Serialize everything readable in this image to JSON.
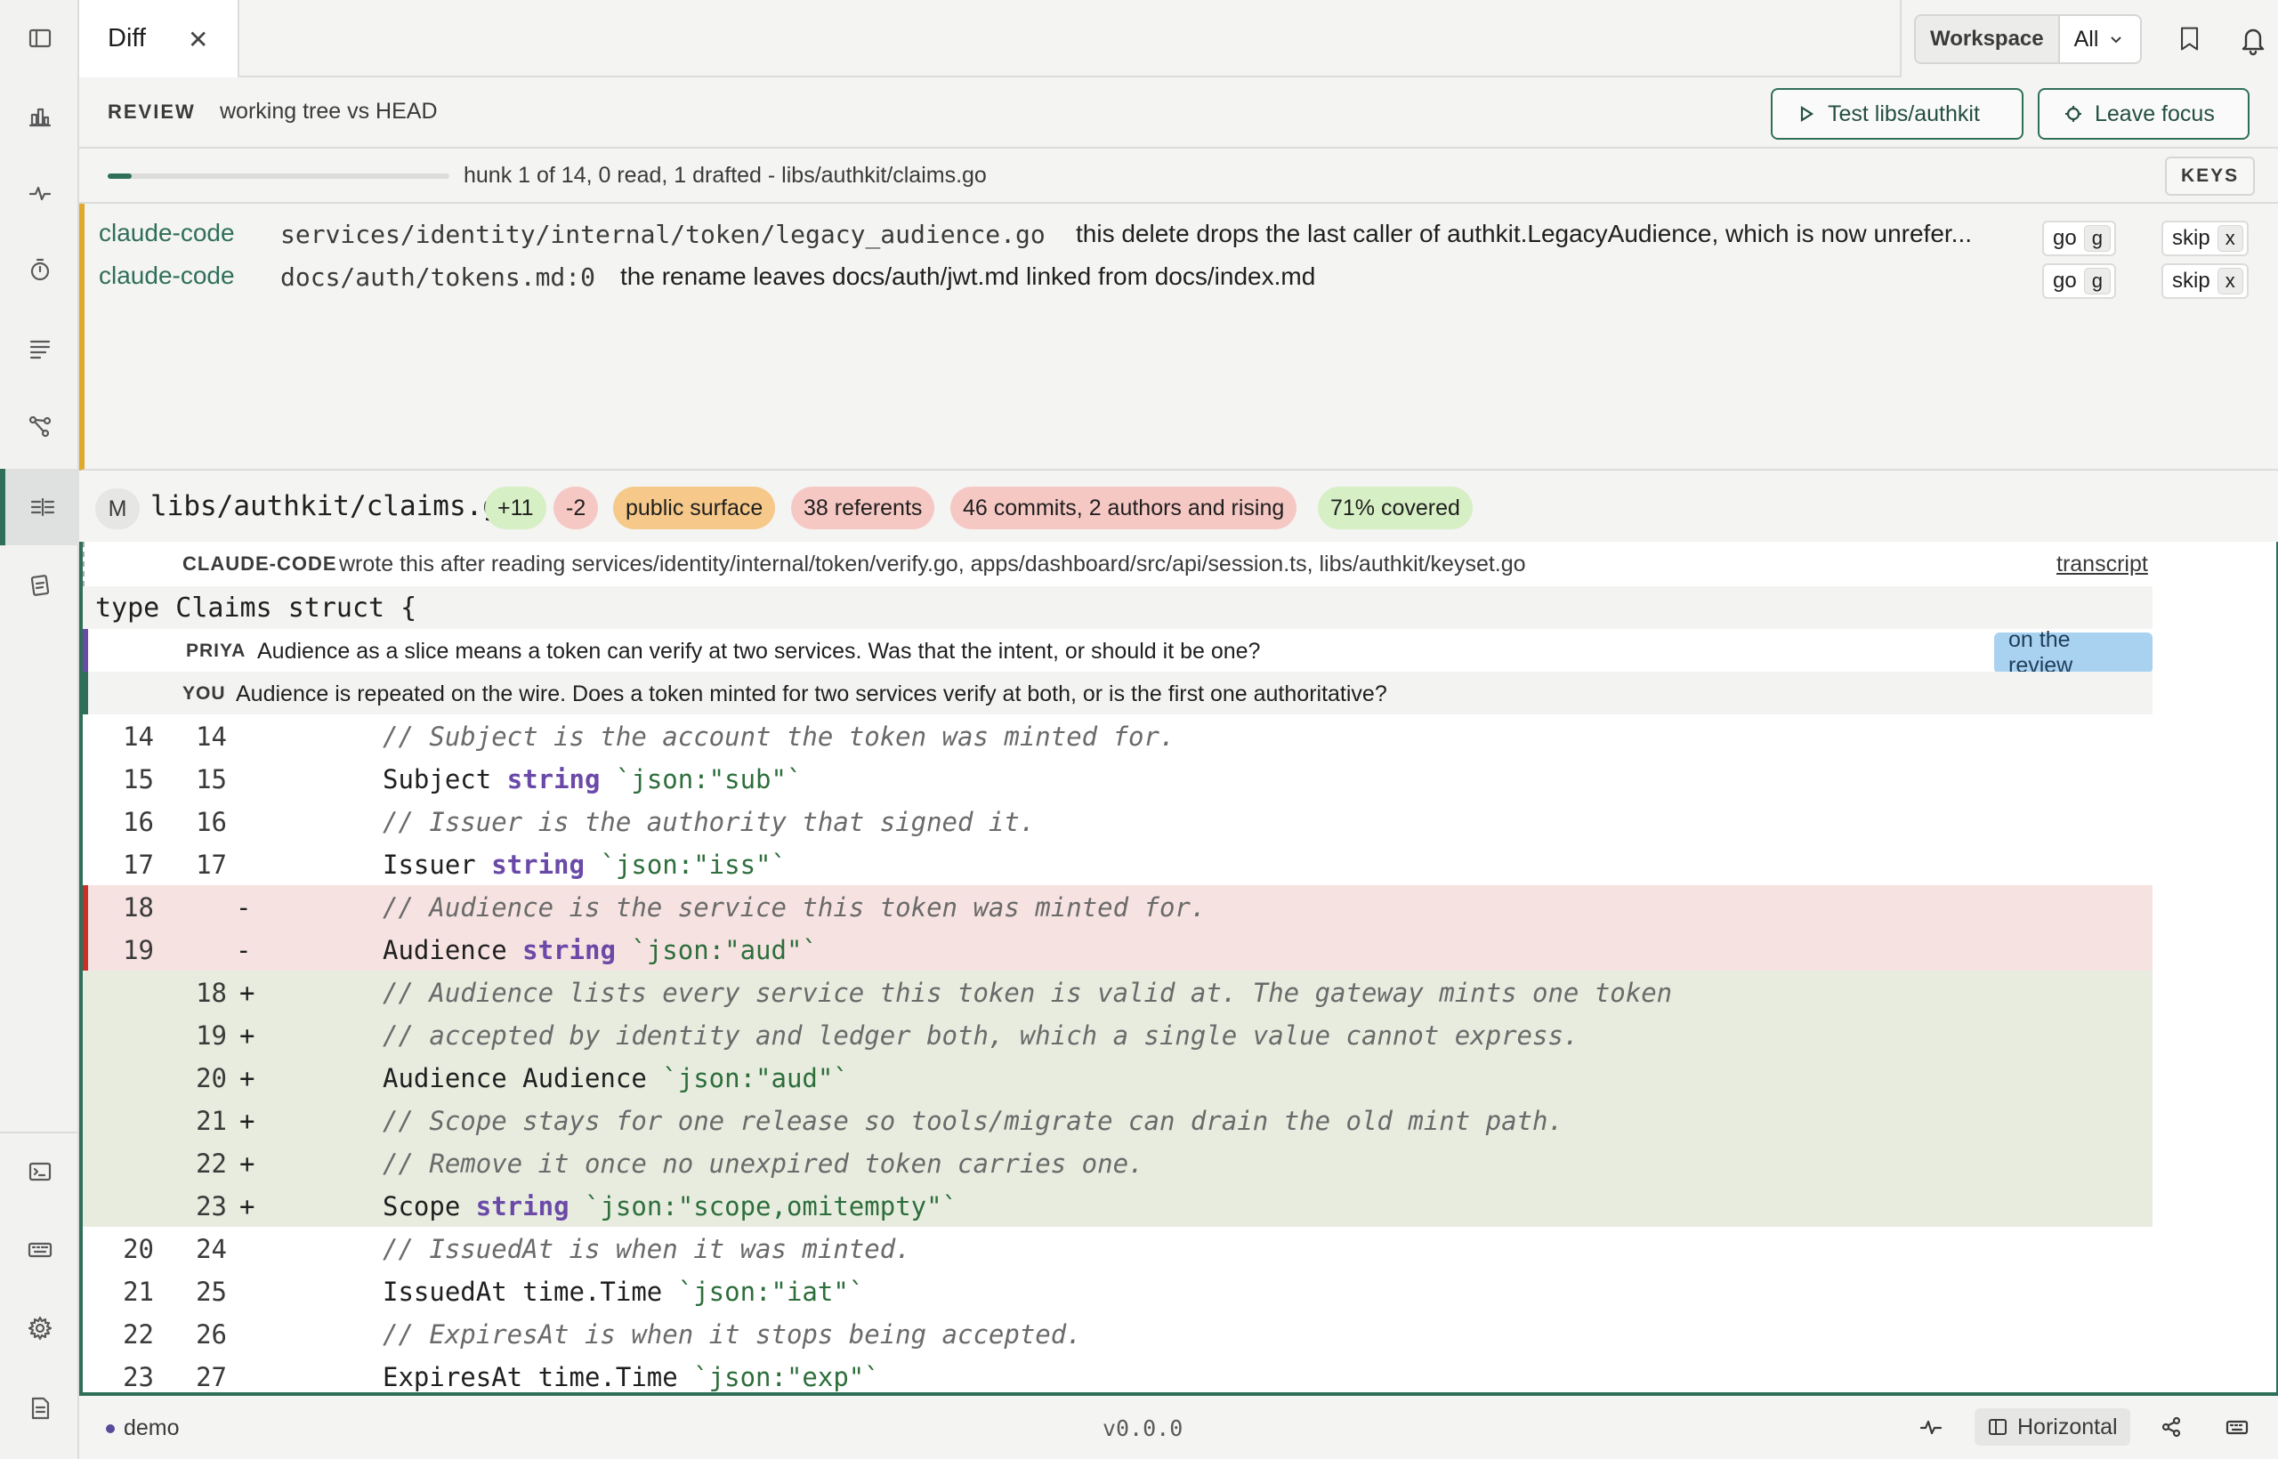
{
  "tabs": [
    {
      "label": "Diff"
    }
  ],
  "header": {
    "workspace_label": "Workspace",
    "workspace_value": "All"
  },
  "review": {
    "label": "REVIEW",
    "subtitle": "working tree vs HEAD",
    "test_button": "Test libs/authkit",
    "focus_button": "Leave focus"
  },
  "progress": {
    "fraction": 0.071,
    "text": "hunk 1 of 14, 0 read, 1 drafted - libs/authkit/claims.go",
    "keys_label": "KEYS"
  },
  "findings": [
    {
      "agent": "claude-code",
      "path": "services/identity/internal/token/legacy_audience.go",
      "message": "this delete drops the last caller of authkit.LegacyAudience, which is now unrefer...",
      "go_label": "go",
      "go_key": "g",
      "skip_label": "skip",
      "skip_key": "x"
    },
    {
      "agent": "claude-code",
      "path": "docs/auth/tokens.md:0",
      "message": "the rename leaves docs/auth/jwt.md linked from docs/index.md",
      "go_label": "go",
      "go_key": "g",
      "skip_label": "skip",
      "skip_key": "x"
    }
  ],
  "file": {
    "status": "M",
    "path": "libs/authkit/claims.go",
    "chips": [
      {
        "label": "+11",
        "color": "#d6efc4"
      },
      {
        "label": "-2",
        "color": "#f6c8c4"
      },
      {
        "label": "public surface",
        "color": "#f6c98a"
      },
      {
        "label": "38 referents",
        "color": "#f6c8c4"
      },
      {
        "label": "46 commits, 2 authors and rising",
        "color": "#f6c8c4"
      },
      {
        "label": "71% covered",
        "color": "#d6efc4"
      }
    ]
  },
  "provenance": {
    "who": "CLAUDE-CODE",
    "text": "wrote this after reading services/identity/internal/token/verify.go, apps/dashboard/src/api/session.ts, libs/authkit/keyset.go",
    "link": "transcript"
  },
  "context_line": "type Claims struct {",
  "comments": [
    {
      "who": "PRIYA",
      "text": "Audience as a slice means a token can verify at two services. Was that the intent, or should it be one?",
      "tag": "on the review"
    },
    {
      "who": "YOU",
      "text": "Audience is repeated on the wire. Does a token minted for two services verify at both, or is the first one authoritative?"
    }
  ],
  "code_lines": [
    {
      "type": "ctx",
      "old": "14",
      "new": "14",
      "mark": "",
      "parts": [
        [
          "cm",
          "// Subject is the account the token was minted for."
        ]
      ]
    },
    {
      "type": "ctx",
      "old": "15",
      "new": "15",
      "mark": "",
      "parts": [
        [
          "",
          "Subject "
        ],
        [
          "kw",
          "string"
        ],
        [
          "",
          " "
        ],
        [
          "str",
          "`json:\"sub\"`"
        ]
      ]
    },
    {
      "type": "ctx",
      "old": "16",
      "new": "16",
      "mark": "",
      "parts": [
        [
          "cm",
          "// Issuer is the authority that signed it."
        ]
      ]
    },
    {
      "type": "ctx",
      "old": "17",
      "new": "17",
      "mark": "",
      "parts": [
        [
          "",
          "Issuer "
        ],
        [
          "kw",
          "string"
        ],
        [
          "",
          " "
        ],
        [
          "str",
          "`json:\"iss\"`"
        ]
      ]
    },
    {
      "type": "del",
      "old": "18",
      "new": "",
      "mark": "-",
      "parts": [
        [
          "cm",
          "// Audience is the service this token was minted for."
        ]
      ]
    },
    {
      "type": "del",
      "old": "19",
      "new": "",
      "mark": "-",
      "parts": [
        [
          "",
          "Audience "
        ],
        [
          "kw",
          "string"
        ],
        [
          "",
          " "
        ],
        [
          "str",
          "`json:\"aud\"`"
        ]
      ]
    },
    {
      "type": "add",
      "old": "",
      "new": "18",
      "mark": "+",
      "parts": [
        [
          "cm",
          "// Audience lists every service this token is valid at. The gateway mints one token"
        ]
      ]
    },
    {
      "type": "add",
      "old": "",
      "new": "19",
      "mark": "+",
      "parts": [
        [
          "cm",
          "// accepted by identity and ledger both, which a single value cannot express."
        ]
      ]
    },
    {
      "type": "add",
      "old": "",
      "new": "20",
      "mark": "+",
      "parts": [
        [
          "",
          "Audience Audience "
        ],
        [
          "str",
          "`json:\"aud\"`"
        ]
      ]
    },
    {
      "type": "add",
      "old": "",
      "new": "21",
      "mark": "+",
      "parts": [
        [
          "cm",
          "// Scope stays for one release so tools/migrate can drain the old mint path."
        ]
      ]
    },
    {
      "type": "add",
      "old": "",
      "new": "22",
      "mark": "+",
      "parts": [
        [
          "cm",
          "// Remove it once no unexpired token carries one."
        ]
      ]
    },
    {
      "type": "add",
      "old": "",
      "new": "23",
      "mark": "+",
      "parts": [
        [
          "",
          "Scope "
        ],
        [
          "kw",
          "string"
        ],
        [
          "",
          " "
        ],
        [
          "str",
          "`json:\"scope,omitempty\"`"
        ]
      ]
    },
    {
      "type": "ctx",
      "old": "20",
      "new": "24",
      "mark": "",
      "parts": [
        [
          "cm",
          "// IssuedAt is when it was minted."
        ]
      ]
    },
    {
      "type": "ctx",
      "old": "21",
      "new": "25",
      "mark": "",
      "parts": [
        [
          "",
          "IssuedAt time.Time "
        ],
        [
          "str",
          "`json:\"iat\"`"
        ]
      ]
    },
    {
      "type": "ctx",
      "old": "22",
      "new": "26",
      "mark": "",
      "parts": [
        [
          "cm",
          "// ExpiresAt is when it stops being accepted."
        ]
      ]
    },
    {
      "type": "ctx",
      "old": "23",
      "new": "27",
      "mark": "",
      "parts": [
        [
          "",
          "ExpiresAt time.Time "
        ],
        [
          "str",
          "`json:\"exp\"`"
        ]
      ]
    }
  ],
  "statusbar": {
    "env": "demo",
    "version": "v0.0.0",
    "layout": "Horizontal"
  }
}
